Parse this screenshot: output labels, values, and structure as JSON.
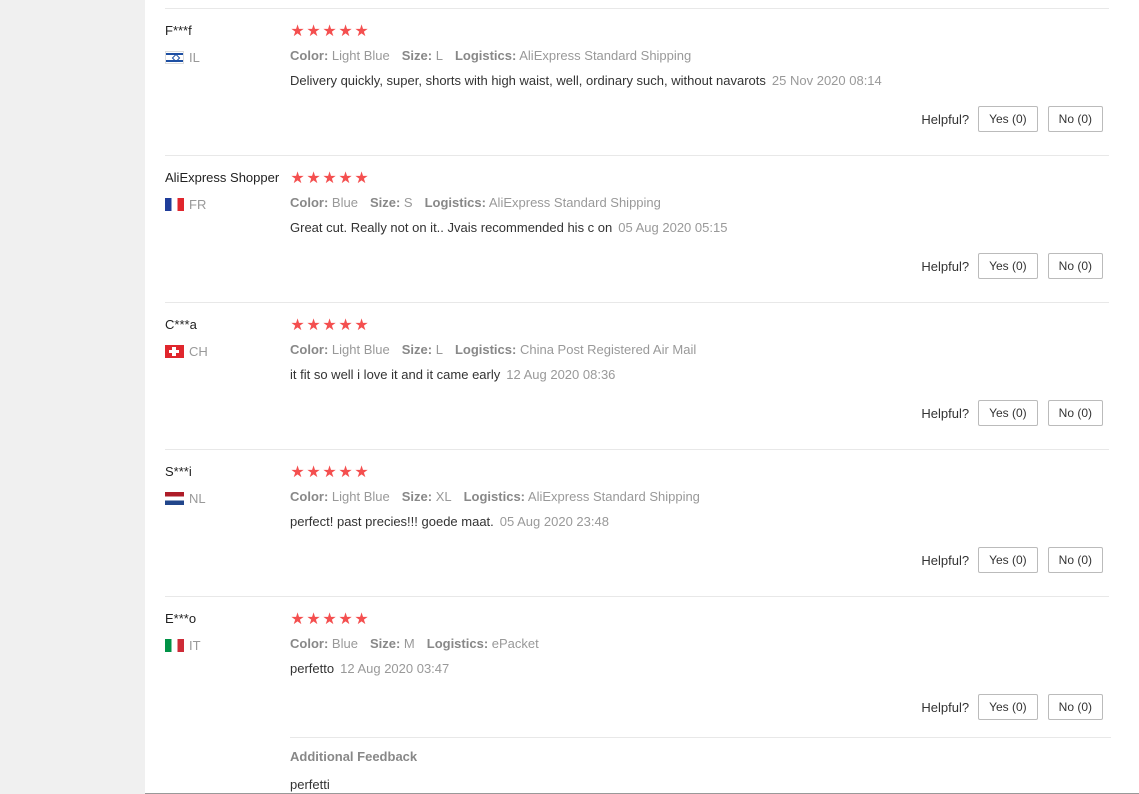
{
  "helpful_label": "Helpful?",
  "attr_keys": {
    "color": "Color:",
    "size": "Size:",
    "logistics": "Logistics:"
  },
  "reviews": [
    {
      "user": "F***f",
      "country": "IL",
      "stars": 5,
      "color": "Light Blue",
      "size": "L",
      "logistics": "AliExpress Standard Shipping",
      "text": "Delivery quickly, super, shorts with high waist, well, ordinary such, without navarots",
      "date": "25 Nov 2020 08:14",
      "yes": "Yes (0)",
      "no": "No (0)"
    },
    {
      "user": "AliExpress Shopper",
      "country": "FR",
      "stars": 5,
      "color": "Blue",
      "size": "S",
      "logistics": "AliExpress Standard Shipping",
      "text": "Great cut. Really not on it.. Jvais recommended his c on",
      "date": "05 Aug 2020 05:15",
      "yes": "Yes (0)",
      "no": "No (0)"
    },
    {
      "user": "C***a",
      "country": "CH",
      "stars": 5,
      "color": "Light Blue",
      "size": "L",
      "logistics": "China Post Registered Air Mail",
      "text": "it fit so well i love it and it came early",
      "date": "12 Aug 2020 08:36",
      "yes": "Yes (0)",
      "no": "No (0)"
    },
    {
      "user": "S***i",
      "country": "NL",
      "stars": 5,
      "color": "Light Blue",
      "size": "XL",
      "logistics": "AliExpress Standard Shipping",
      "text": "perfect! past precies!!! goede maat.",
      "date": "05 Aug 2020 23:48",
      "yes": "Yes (0)",
      "no": "No (0)"
    },
    {
      "user": "E***o",
      "country": "IT",
      "stars": 5,
      "color": "Blue",
      "size": "M",
      "logistics": "ePacket",
      "text": "perfetto",
      "date": "12 Aug 2020 03:47",
      "yes": "Yes (0)",
      "no": "No (0)",
      "additional": {
        "title": "Additional Feedback",
        "text": "perfetti"
      }
    }
  ]
}
